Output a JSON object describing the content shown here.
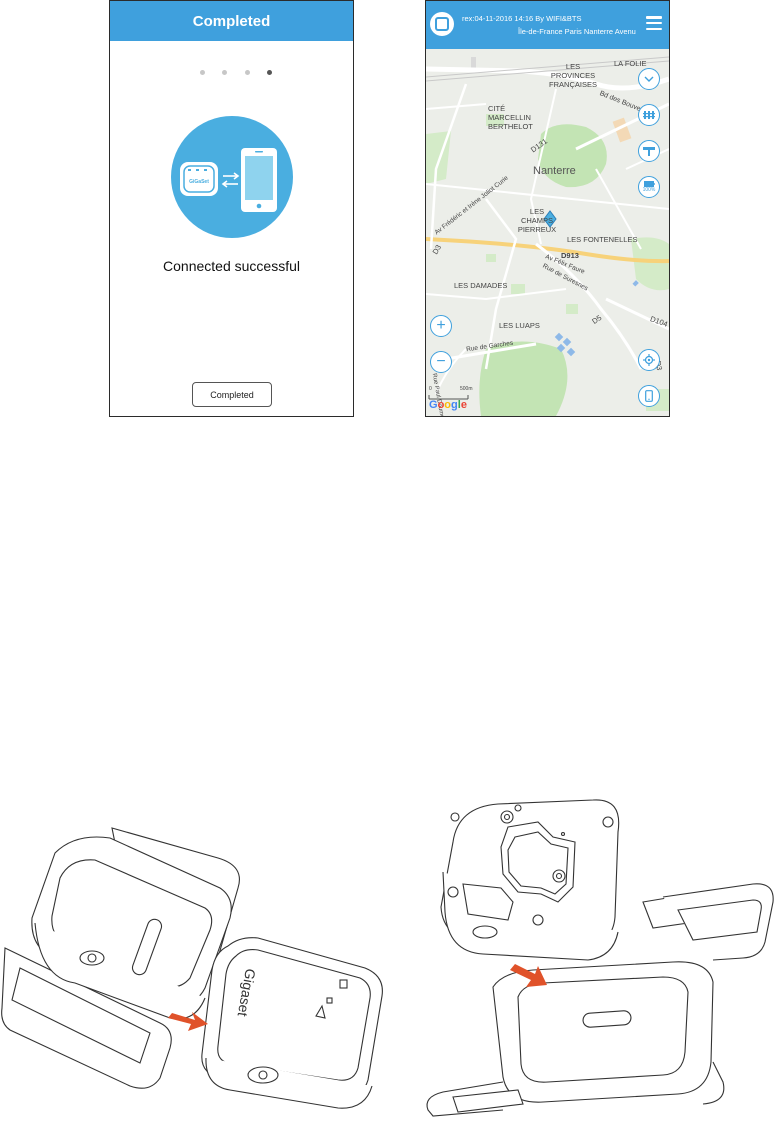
{
  "screen1": {
    "title": "Completed",
    "progress_dots": {
      "count": 4,
      "active_index": 3
    },
    "device_label": "GiGaSet",
    "message": "Connected successful",
    "button_label": "Completed"
  },
  "screen2": {
    "header": {
      "line1": "rex:04-11-2016 14:16 By WIFI&BTS",
      "line2": "Île-de-France Paris Nanterre Avenu"
    },
    "map_labels": [
      "LA FOLIE",
      "LES PROVINCES FRANÇAISES",
      "Bd des Bouvets",
      "CITÉ MARCELLIN BERTHELOT",
      "D131",
      "Nanterre",
      "Av Frédéric et Irène Joliot Curie",
      "LES CHAMPS PIERREUX",
      "LES FONTENELLES",
      "D913",
      "Av Félix Faure",
      "Rue de Suresnes",
      "D3",
      "LES DAMADES",
      "LES LUAPS",
      "D5",
      "D104",
      "Rue de Garches",
      "Rue Paul Doumer",
      "D3"
    ],
    "scale": {
      "left": "0",
      "right": "500m"
    },
    "battery": "100%",
    "google_logo": "Google",
    "buttons": {
      "collapse": "chevron-down-icon",
      "fence": "fence-icon",
      "history": "history-icon",
      "battery": "battery-icon",
      "zoom_in": "+",
      "zoom_out": "−",
      "locate": "crosshair-icon",
      "device": "phone-icon"
    }
  },
  "illustrations": {
    "left": {
      "brand": "Gigaset",
      "arrow_color": "#e0522a"
    },
    "right": {
      "arrow_color": "#e0522a"
    }
  },
  "colors": {
    "accent": "#3fa0dd",
    "circle": "#4aaee0",
    "arrow": "#e0522a"
  }
}
